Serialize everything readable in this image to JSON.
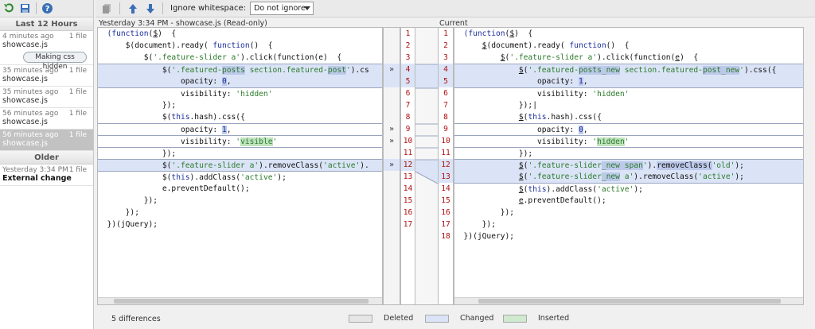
{
  "history": {
    "group_recent": "Last 12 Hours",
    "group_older": "Older",
    "entries": [
      {
        "time": "4 minutes ago",
        "count": "1 file",
        "file": "showcase.js",
        "label": "Making css hidden"
      },
      {
        "time": "35 minutes ago",
        "count": "1 file",
        "file": "showcase.js"
      },
      {
        "time": "35 minutes ago",
        "count": "1 file",
        "file": "showcase.js"
      },
      {
        "time": "56 minutes ago",
        "count": "1 file",
        "file": "showcase.js"
      },
      {
        "time": "56 minutes ago",
        "count": "1 file",
        "file": "showcase.js",
        "selected": true
      }
    ],
    "older_entry": {
      "time": "Yesterday 3:34 PM",
      "count": "1 file",
      "file": "External change"
    }
  },
  "toolbar": {
    "ignore_label": "Ignore whitespace:",
    "ignore_value": "Do not ignore"
  },
  "left_pane": {
    "title": "Yesterday 3:34 PM - showcase.js (Read-only)"
  },
  "right_pane": {
    "title": "Current"
  },
  "left_line_numbers": [
    "1",
    "2",
    "3",
    "4",
    "5",
    "6",
    "7",
    "8",
    "9",
    "10",
    "11",
    "12",
    "13",
    "14",
    "15",
    "16",
    "17"
  ],
  "right_line_numbers": [
    "1",
    "2",
    "3",
    "4",
    "5",
    "6",
    "7",
    "8",
    "9",
    "10",
    "11",
    "12",
    "13",
    "14",
    "15",
    "16",
    "17",
    "18"
  ],
  "arrows": {
    "line4": "»",
    "line9": "»",
    "line10": "»",
    "line12": "»"
  },
  "status": {
    "differences": "5 differences",
    "legend_deleted": "Deleted",
    "legend_changed": "Changed",
    "legend_inserted": "Inserted"
  },
  "colors": {
    "changed": "#dbe4f7",
    "deleted": "#e6e6e6",
    "inserted": "#cfeacf",
    "line_number": "#b01010"
  }
}
